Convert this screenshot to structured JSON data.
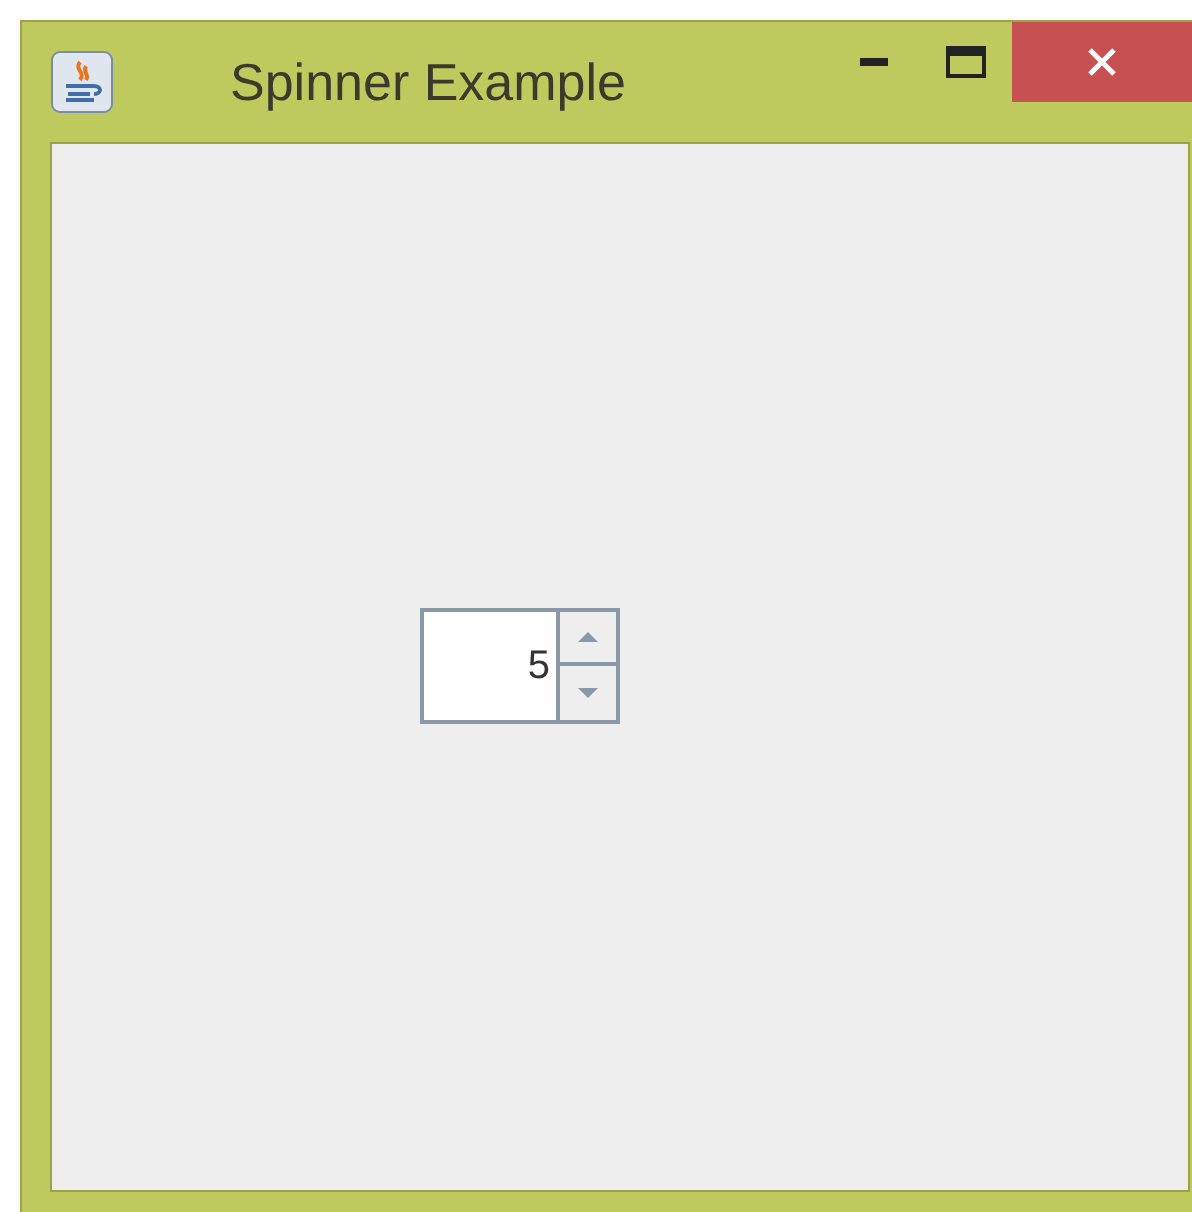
{
  "window": {
    "title": "Spinner Example"
  },
  "spinner": {
    "value": "5"
  }
}
